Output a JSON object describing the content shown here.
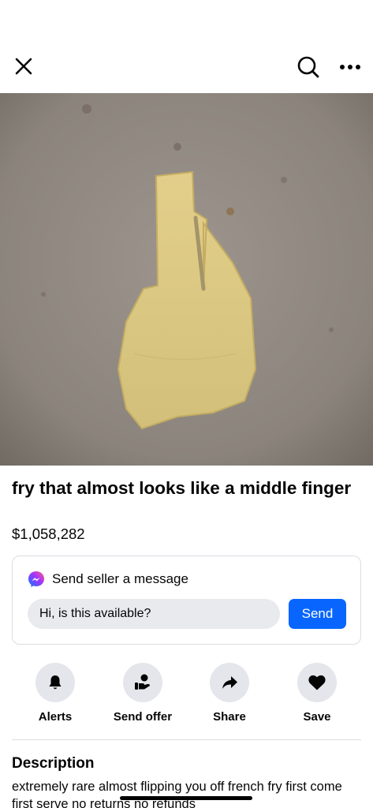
{
  "listing": {
    "title": "fry that almost looks like a middle finger",
    "price": "$1,058,282"
  },
  "topbar": {
    "icons": [
      "close-icon",
      "search-icon",
      "more-options-icon"
    ]
  },
  "message_card": {
    "heading": "Send seller a message",
    "input_value": "Hi, is this available?",
    "send_label": "Send",
    "icon": "messenger-icon"
  },
  "actions": [
    {
      "label": "Alerts",
      "icon": "bell-icon"
    },
    {
      "label": "Send offer",
      "icon": "offer-hand-icon"
    },
    {
      "label": "Share",
      "icon": "share-arrow-icon"
    },
    {
      "label": "Save",
      "icon": "heart-icon"
    }
  ],
  "description": {
    "heading": "Description",
    "text": "extremely rare almost flipping you off french fry first come first serve no returns no refunds"
  },
  "colors": {
    "accent": "#0866ff",
    "icon_bg": "#e4e6eb",
    "text": "#050505"
  }
}
